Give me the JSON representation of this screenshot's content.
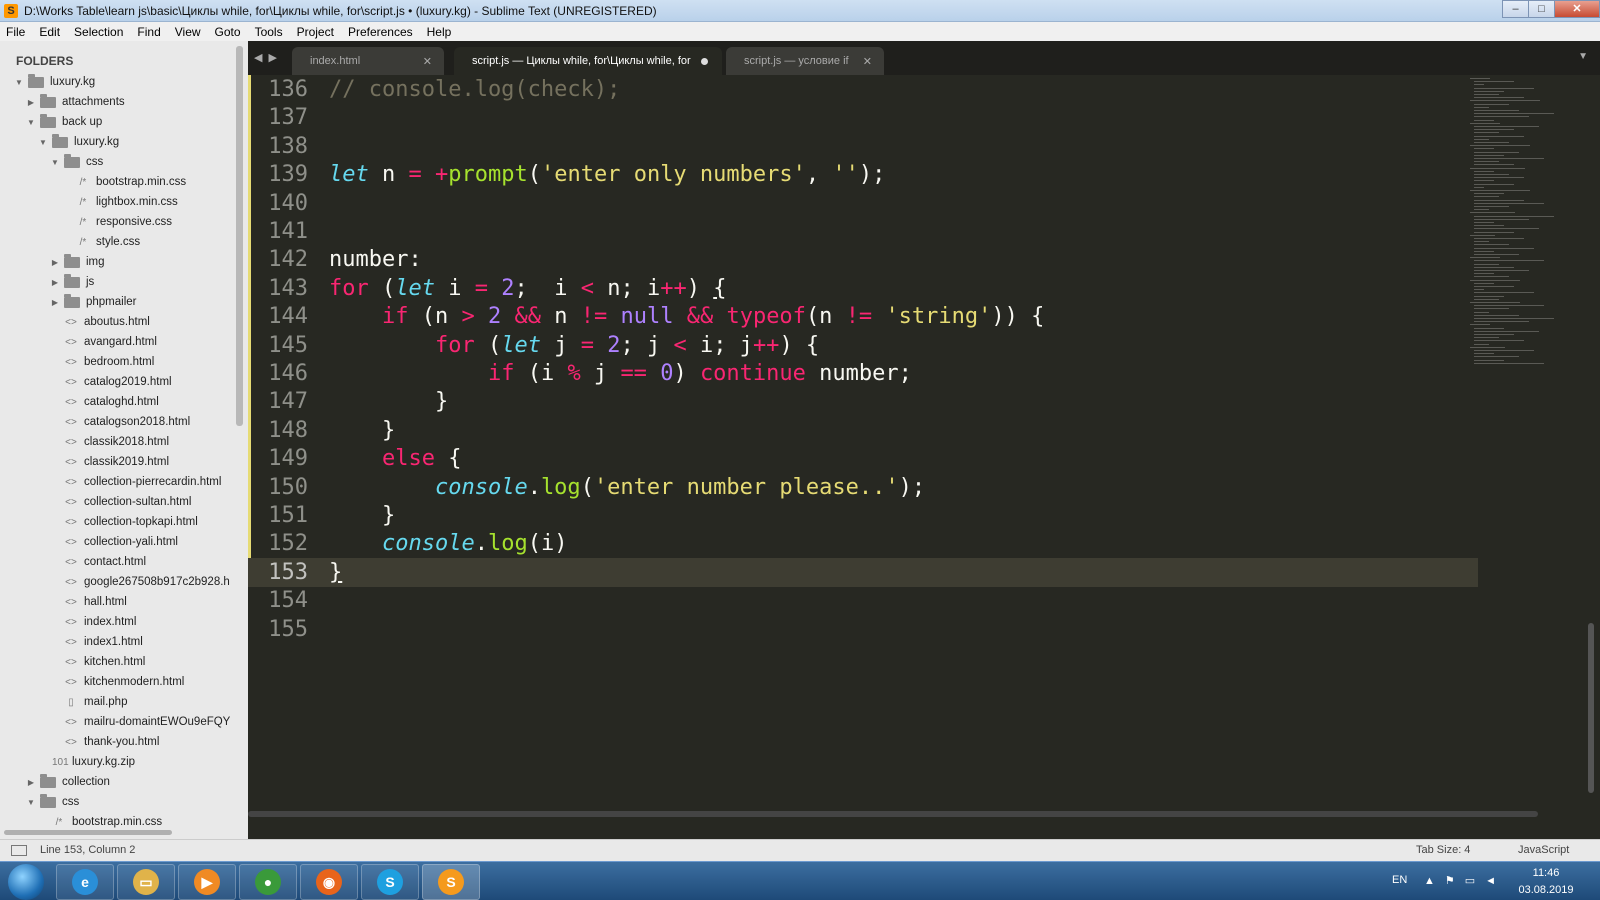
{
  "window": {
    "title": "D:\\Works Table\\learn js\\basic\\Циклы while, for\\Циклы while, for\\script.js • (luxury.kg) - Sublime Text (UNREGISTERED)",
    "controls": {
      "minimize": "–",
      "maximize": "□",
      "close": "✕"
    }
  },
  "menu": [
    "File",
    "Edit",
    "Selection",
    "Find",
    "View",
    "Goto",
    "Tools",
    "Project",
    "Preferences",
    "Help"
  ],
  "sidebar": {
    "heading": "FOLDERS",
    "items": [
      {
        "label": "luxury.kg",
        "type": "folder",
        "depth": 0,
        "expanded": true
      },
      {
        "label": "attachments",
        "type": "folder",
        "depth": 1,
        "expanded": false
      },
      {
        "label": "back up",
        "type": "folder",
        "depth": 1,
        "expanded": true
      },
      {
        "label": "luxury.kg",
        "type": "folder",
        "depth": 2,
        "expanded": true
      },
      {
        "label": "css",
        "type": "folder",
        "depth": 3,
        "expanded": true
      },
      {
        "label": "bootstrap.min.css",
        "type": "css",
        "depth": 4
      },
      {
        "label": "lightbox.min.css",
        "type": "css",
        "depth": 4
      },
      {
        "label": "responsive.css",
        "type": "css",
        "depth": 4
      },
      {
        "label": "style.css",
        "type": "css",
        "depth": 4
      },
      {
        "label": "img",
        "type": "folder",
        "depth": 3,
        "expanded": false
      },
      {
        "label": "js",
        "type": "folder",
        "depth": 3,
        "expanded": false
      },
      {
        "label": "phpmailer",
        "type": "folder",
        "depth": 3,
        "expanded": false
      },
      {
        "label": "aboutus.html",
        "type": "html",
        "depth": 3
      },
      {
        "label": "avangard.html",
        "type": "html",
        "depth": 3
      },
      {
        "label": "bedroom.html",
        "type": "html",
        "depth": 3
      },
      {
        "label": "catalog2019.html",
        "type": "html",
        "depth": 3
      },
      {
        "label": "cataloghd.html",
        "type": "html",
        "depth": 3
      },
      {
        "label": "catalogson2018.html",
        "type": "html",
        "depth": 3
      },
      {
        "label": "classik2018.html",
        "type": "html",
        "depth": 3
      },
      {
        "label": "classik2019.html",
        "type": "html",
        "depth": 3
      },
      {
        "label": "collection-pierrecardin.html",
        "type": "html",
        "depth": 3
      },
      {
        "label": "collection-sultan.html",
        "type": "html",
        "depth": 3
      },
      {
        "label": "collection-topkapi.html",
        "type": "html",
        "depth": 3
      },
      {
        "label": "collection-yali.html",
        "type": "html",
        "depth": 3
      },
      {
        "label": "contact.html",
        "type": "html",
        "depth": 3
      },
      {
        "label": "google267508b917c2b928.h",
        "type": "html",
        "depth": 3
      },
      {
        "label": "hall.html",
        "type": "html",
        "depth": 3
      },
      {
        "label": "index.html",
        "type": "html",
        "depth": 3
      },
      {
        "label": "index1.html",
        "type": "html",
        "depth": 3
      },
      {
        "label": "kitchen.html",
        "type": "html",
        "depth": 3
      },
      {
        "label": "kitchenmodern.html",
        "type": "html",
        "depth": 3
      },
      {
        "label": "mail.php",
        "type": "php",
        "depth": 3
      },
      {
        "label": "mailru-domaintEWOu9eFQY",
        "type": "html",
        "depth": 3
      },
      {
        "label": "thank-you.html",
        "type": "html",
        "depth": 3
      },
      {
        "label": "luxury.kg.zip",
        "type": "zip",
        "depth": 2
      },
      {
        "label": "collection",
        "type": "folder",
        "depth": 1,
        "expanded": false
      },
      {
        "label": "css",
        "type": "folder",
        "depth": 1,
        "expanded": true
      },
      {
        "label": "bootstrap.min.css",
        "type": "css",
        "depth": 2
      }
    ]
  },
  "tabs": [
    {
      "label": "index.html",
      "active": false,
      "dirty": false
    },
    {
      "label": "script.js — Циклы while, for\\Циклы while, for",
      "active": true,
      "dirty": true
    },
    {
      "label": "script.js — условие if",
      "active": false,
      "dirty": false
    }
  ],
  "editor": {
    "current_line": 153,
    "lines": [
      {
        "n": "136",
        "tokens": [
          [
            "c-com",
            "// console.log(check);"
          ]
        ]
      },
      {
        "n": "137",
        "tokens": []
      },
      {
        "n": "138",
        "tokens": []
      },
      {
        "n": "139",
        "tokens": [
          [
            "c-st",
            "let"
          ],
          [
            "",
            " n "
          ],
          [
            "c-op",
            "="
          ],
          [
            "",
            " "
          ],
          [
            "c-op",
            "+"
          ],
          [
            "c-fn",
            "prompt"
          ],
          [
            "",
            "("
          ],
          [
            "c-str",
            "'enter only numbers'"
          ],
          [
            "",
            ", "
          ],
          [
            "c-str",
            "''"
          ],
          [
            "",
            ");"
          ]
        ]
      },
      {
        "n": "140",
        "tokens": []
      },
      {
        "n": "141",
        "tokens": []
      },
      {
        "n": "142",
        "tokens": [
          [
            "",
            "number:"
          ]
        ]
      },
      {
        "n": "143",
        "tokens": [
          [
            "c-kw",
            "for"
          ],
          [
            "",
            " ("
          ],
          [
            "c-st",
            "let"
          ],
          [
            "",
            " i "
          ],
          [
            "c-op",
            "="
          ],
          [
            "",
            " "
          ],
          [
            "c-num",
            "2"
          ],
          [
            "",
            ";  i "
          ],
          [
            "c-op",
            "<"
          ],
          [
            "",
            " n; i"
          ],
          [
            "c-op",
            "++"
          ],
          [
            "",
            ") "
          ],
          [
            "c-ul",
            "{"
          ]
        ]
      },
      {
        "n": "144",
        "tokens": [
          [
            "",
            "    "
          ],
          [
            "c-kw",
            "if"
          ],
          [
            "",
            " (n "
          ],
          [
            "c-op",
            ">"
          ],
          [
            "",
            " "
          ],
          [
            "c-num",
            "2"
          ],
          [
            "",
            " "
          ],
          [
            "c-op",
            "&&"
          ],
          [
            "",
            " n "
          ],
          [
            "c-op",
            "!="
          ],
          [
            "",
            " "
          ],
          [
            "c-num",
            "null"
          ],
          [
            "",
            " "
          ],
          [
            "c-op",
            "&&"
          ],
          [
            "",
            " "
          ],
          [
            "c-kw",
            "typeof"
          ],
          [
            "",
            "(n "
          ],
          [
            "c-op",
            "!="
          ],
          [
            "",
            " "
          ],
          [
            "c-str",
            "'string'"
          ],
          [
            "",
            ")) {"
          ]
        ]
      },
      {
        "n": "145",
        "tokens": [
          [
            "",
            "        "
          ],
          [
            "c-kw",
            "for"
          ],
          [
            "",
            " ("
          ],
          [
            "c-st",
            "let"
          ],
          [
            "",
            " j "
          ],
          [
            "c-op",
            "="
          ],
          [
            "",
            " "
          ],
          [
            "c-num",
            "2"
          ],
          [
            "",
            "; j "
          ],
          [
            "c-op",
            "<"
          ],
          [
            "",
            " i; j"
          ],
          [
            "c-op",
            "++"
          ],
          [
            "",
            ") {"
          ]
        ]
      },
      {
        "n": "146",
        "tokens": [
          [
            "",
            "            "
          ],
          [
            "c-kw",
            "if"
          ],
          [
            "",
            " (i "
          ],
          [
            "c-op",
            "%"
          ],
          [
            "",
            " j "
          ],
          [
            "c-op",
            "=="
          ],
          [
            "",
            " "
          ],
          [
            "c-num",
            "0"
          ],
          [
            "",
            ") "
          ],
          [
            "c-kw",
            "continue"
          ],
          [
            "",
            " number;"
          ]
        ]
      },
      {
        "n": "147",
        "tokens": [
          [
            "",
            "        }"
          ]
        ]
      },
      {
        "n": "148",
        "tokens": [
          [
            "",
            "    }"
          ]
        ]
      },
      {
        "n": "149",
        "tokens": [
          [
            "",
            "    "
          ],
          [
            "c-kw",
            "else"
          ],
          [
            "",
            " {"
          ]
        ]
      },
      {
        "n": "150",
        "tokens": [
          [
            "",
            "        "
          ],
          [
            "c-st",
            "console"
          ],
          [
            "",
            "."
          ],
          [
            "c-fn",
            "log"
          ],
          [
            "",
            "("
          ],
          [
            "c-str",
            "'enter number please..'"
          ],
          [
            "",
            ");"
          ]
        ]
      },
      {
        "n": "151",
        "tokens": [
          [
            "",
            "    }"
          ]
        ]
      },
      {
        "n": "152",
        "tokens": [
          [
            "",
            "    "
          ],
          [
            "c-st",
            "console"
          ],
          [
            "",
            "."
          ],
          [
            "c-fn",
            "log"
          ],
          [
            "",
            "(i)"
          ]
        ]
      },
      {
        "n": "153",
        "tokens": [
          [
            "c-ul",
            "}"
          ]
        ]
      },
      {
        "n": "154",
        "tokens": []
      },
      {
        "n": "155",
        "tokens": []
      }
    ]
  },
  "status": {
    "position": "Line 153, Column 2",
    "tab_size": "Tab Size: 4",
    "syntax": "JavaScript"
  },
  "taskbar": {
    "apps": [
      {
        "name": "ie-icon",
        "glyph": "e",
        "color": "#2a8fd8"
      },
      {
        "name": "explorer-icon",
        "glyph": "▭",
        "color": "#e0b34a"
      },
      {
        "name": "media-player-icon",
        "glyph": "▶",
        "color": "#f08a24"
      },
      {
        "name": "chrome-icon",
        "glyph": "●",
        "color": "#3a9a3a"
      },
      {
        "name": "firefox-icon",
        "glyph": "◉",
        "color": "#e8641b"
      },
      {
        "name": "skype-icon",
        "glyph": "S",
        "color": "#1ea0e0"
      },
      {
        "name": "sublime-icon",
        "glyph": "S",
        "color": "#f59a1d"
      }
    ],
    "lang": "EN",
    "time": "11:46",
    "date": "03.08.2019"
  }
}
